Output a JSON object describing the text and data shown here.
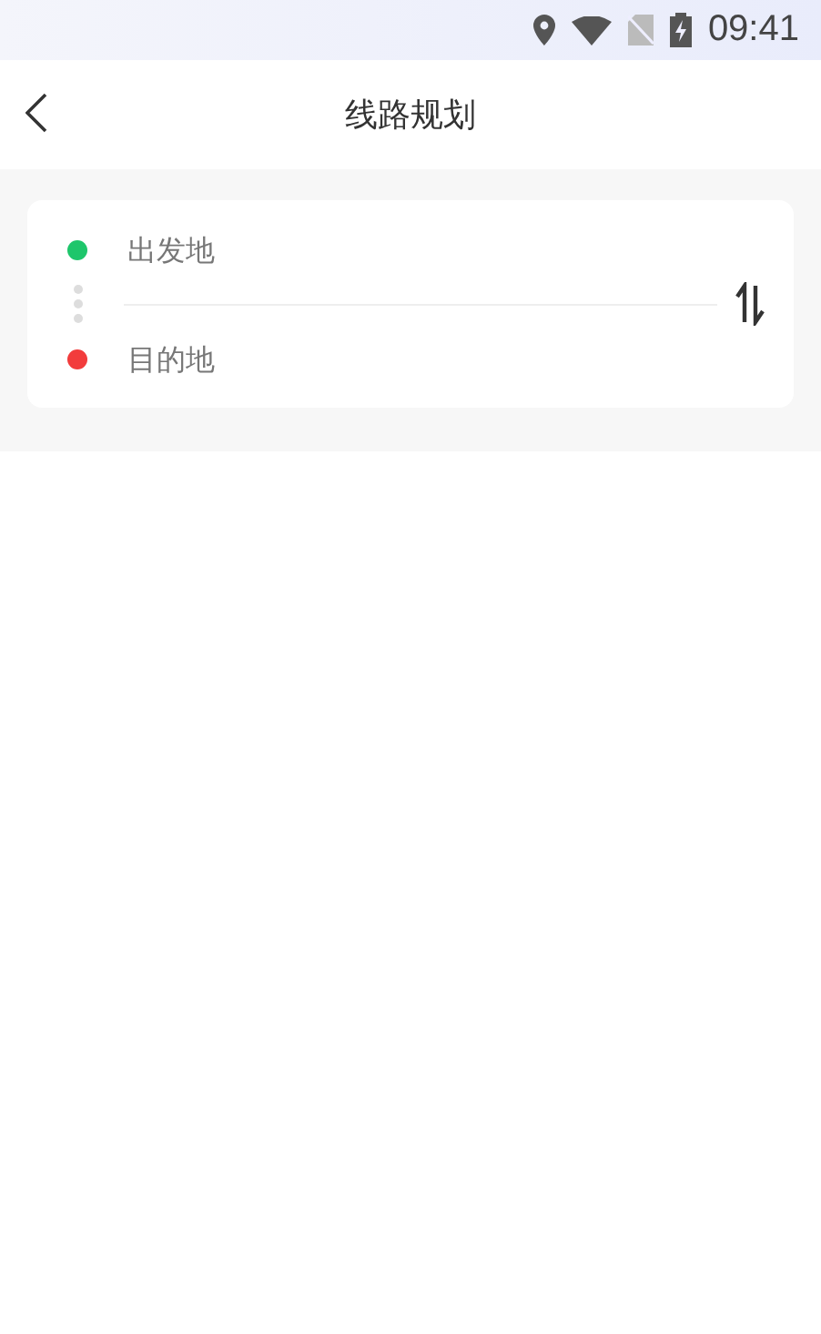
{
  "status_bar": {
    "time": "09:41"
  },
  "header": {
    "title": "线路规划"
  },
  "route": {
    "fields": [
      {
        "placeholder": "出发地",
        "color": "#1ec66b"
      },
      {
        "placeholder": "目的地",
        "color": "#f23c3c"
      }
    ]
  }
}
